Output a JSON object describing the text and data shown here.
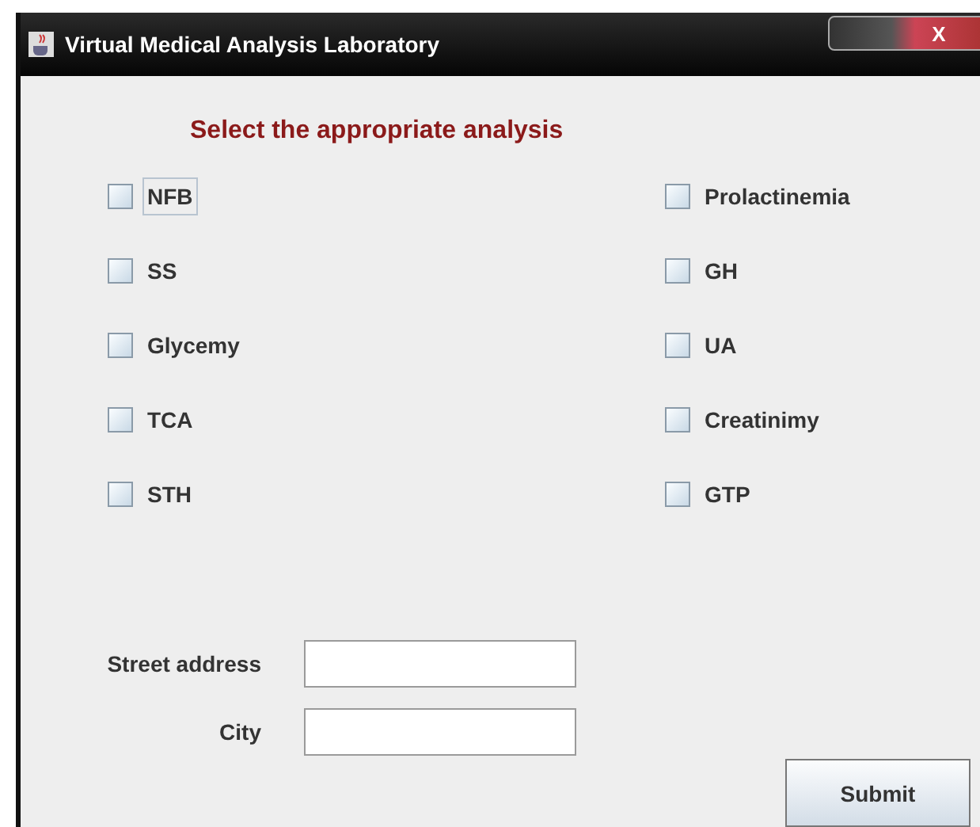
{
  "window": {
    "title": "Virtual Medical Analysis Laboratory",
    "close": "X"
  },
  "heading": "Select the appropriate analysis",
  "analyses": [
    {
      "label": "NFB",
      "checked": false,
      "focused": true
    },
    {
      "label": "Prolactinemia",
      "checked": false,
      "focused": false
    },
    {
      "label": "SS",
      "checked": false,
      "focused": false
    },
    {
      "label": "GH",
      "checked": false,
      "focused": false
    },
    {
      "label": "Glycemy",
      "checked": false,
      "focused": false
    },
    {
      "label": "UA",
      "checked": false,
      "focused": false
    },
    {
      "label": "TCA",
      "checked": false,
      "focused": false
    },
    {
      "label": "Creatinimy",
      "checked": false,
      "focused": false
    },
    {
      "label": "STH",
      "checked": false,
      "focused": false
    },
    {
      "label": "GTP",
      "checked": false,
      "focused": false
    }
  ],
  "fields": [
    {
      "label": "Street address"
    },
    {
      "label": "City"
    }
  ],
  "submit": "Submit"
}
